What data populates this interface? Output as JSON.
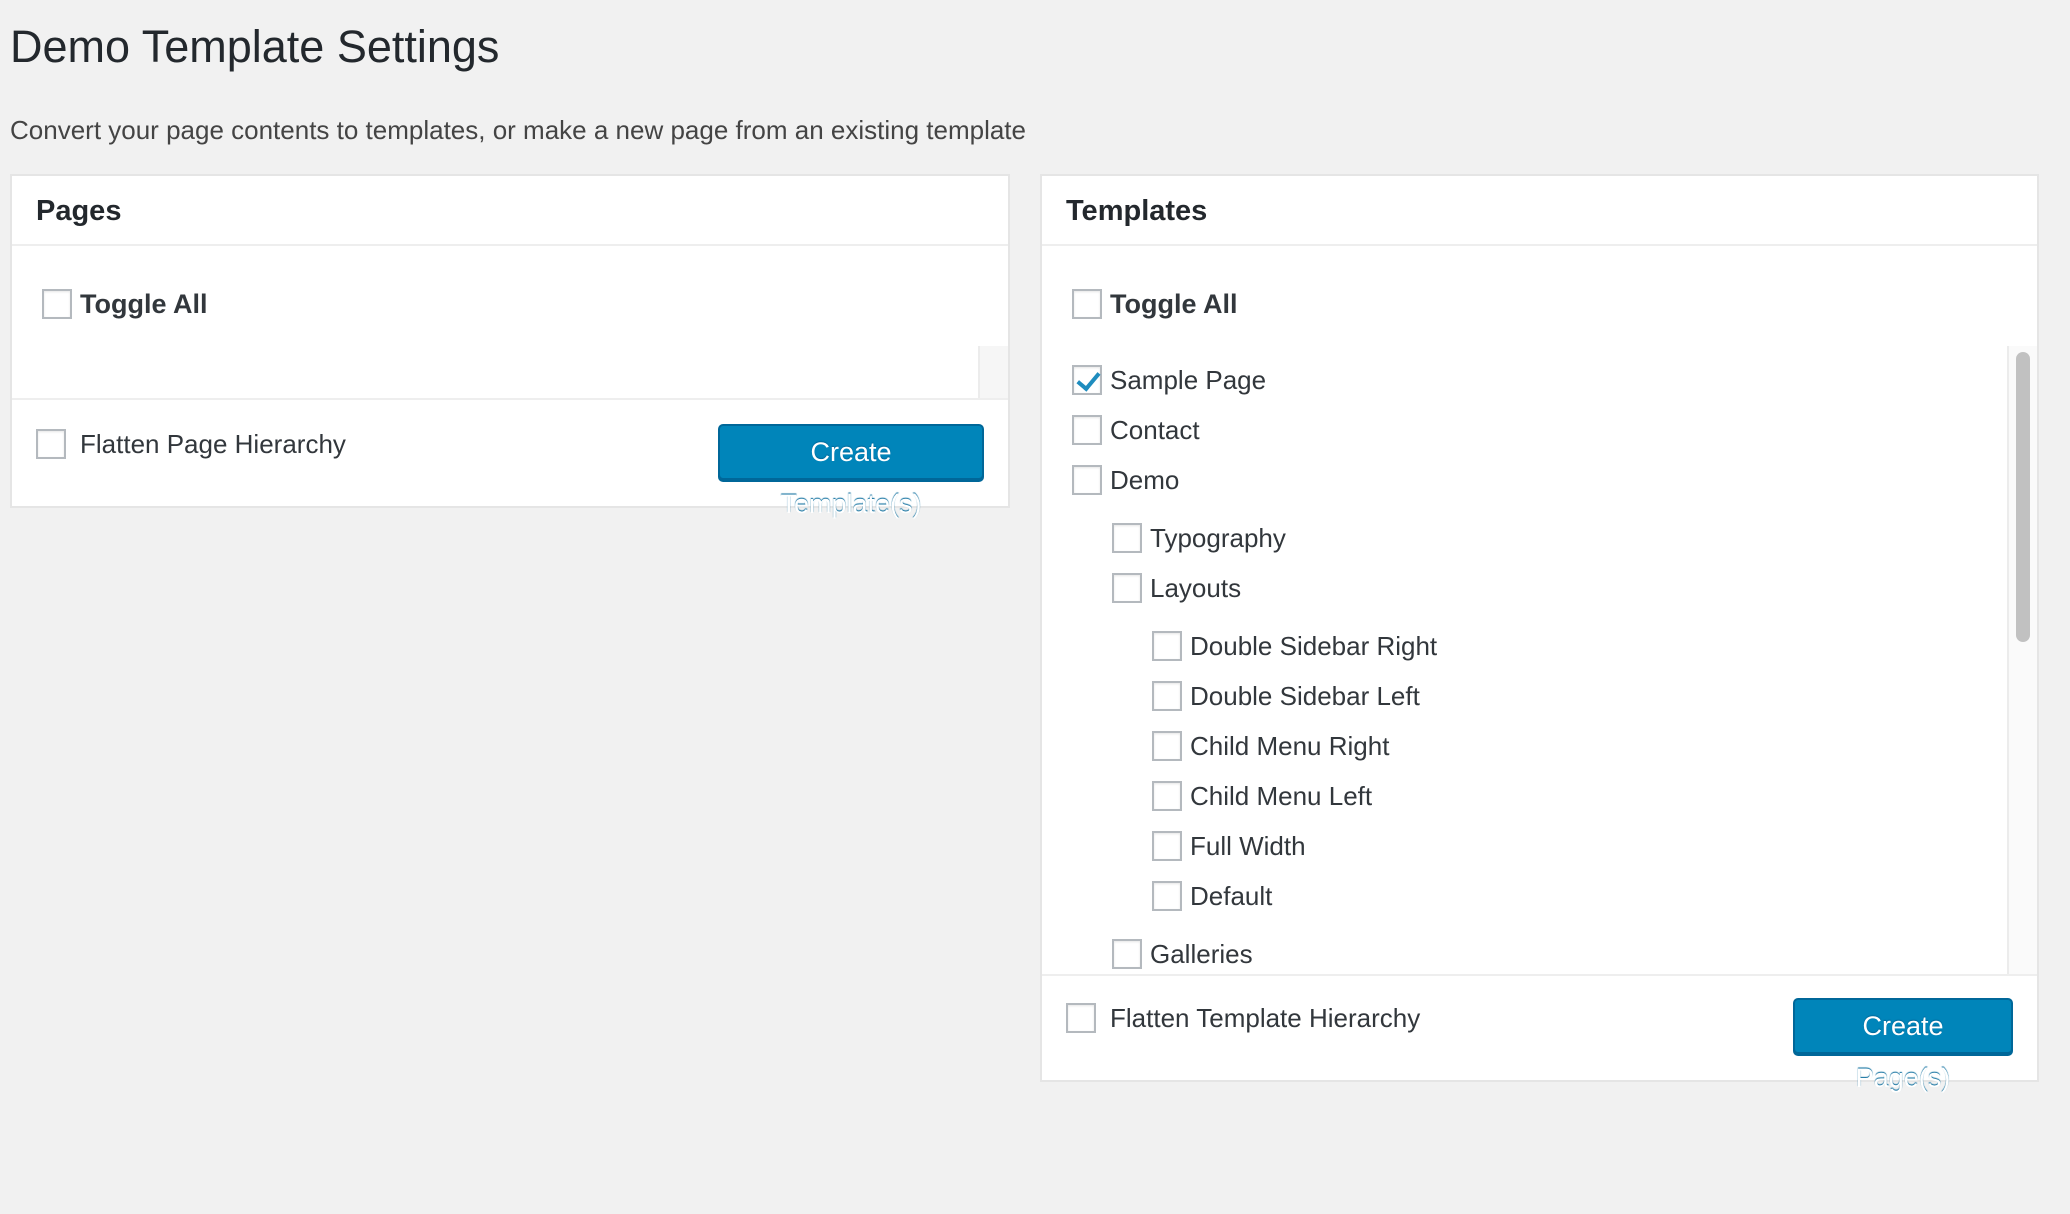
{
  "page": {
    "title": "Demo Template Settings",
    "description": "Convert your page contents to templates, or make a new page from an existing template"
  },
  "pages_panel": {
    "heading": "Pages",
    "toggle_all_label": "Toggle All",
    "toggle_all_checked": false,
    "flatten_label": "Flatten Page Hierarchy",
    "flatten_checked": false,
    "create_button_label": "Create Template(s)"
  },
  "templates_panel": {
    "heading": "Templates",
    "toggle_all_label": "Toggle All",
    "toggle_all_checked": false,
    "items": [
      {
        "label": "Sample Page",
        "level": 0,
        "checked": true
      },
      {
        "label": "Contact",
        "level": 0,
        "checked": false
      },
      {
        "label": "Demo",
        "level": 0,
        "checked": false
      },
      {
        "label": "Typography",
        "level": 1,
        "checked": false
      },
      {
        "label": "Layouts",
        "level": 1,
        "checked": false
      },
      {
        "label": "Double Sidebar Right",
        "level": 2,
        "checked": false
      },
      {
        "label": "Double Sidebar Left",
        "level": 2,
        "checked": false
      },
      {
        "label": "Child Menu Right",
        "level": 2,
        "checked": false
      },
      {
        "label": "Child Menu Left",
        "level": 2,
        "checked": false
      },
      {
        "label": "Full Width",
        "level": 2,
        "checked": false
      },
      {
        "label": "Default",
        "level": 2,
        "checked": false
      },
      {
        "label": "Galleries",
        "level": 1,
        "checked": false
      }
    ],
    "flatten_label": "Flatten Template Hierarchy",
    "flatten_checked": false,
    "create_button_label": "Create Page(s)"
  },
  "colors": {
    "button_primary": "#0085ba",
    "checkmark": "#1e8cbe",
    "background": "#f1f1f1"
  }
}
